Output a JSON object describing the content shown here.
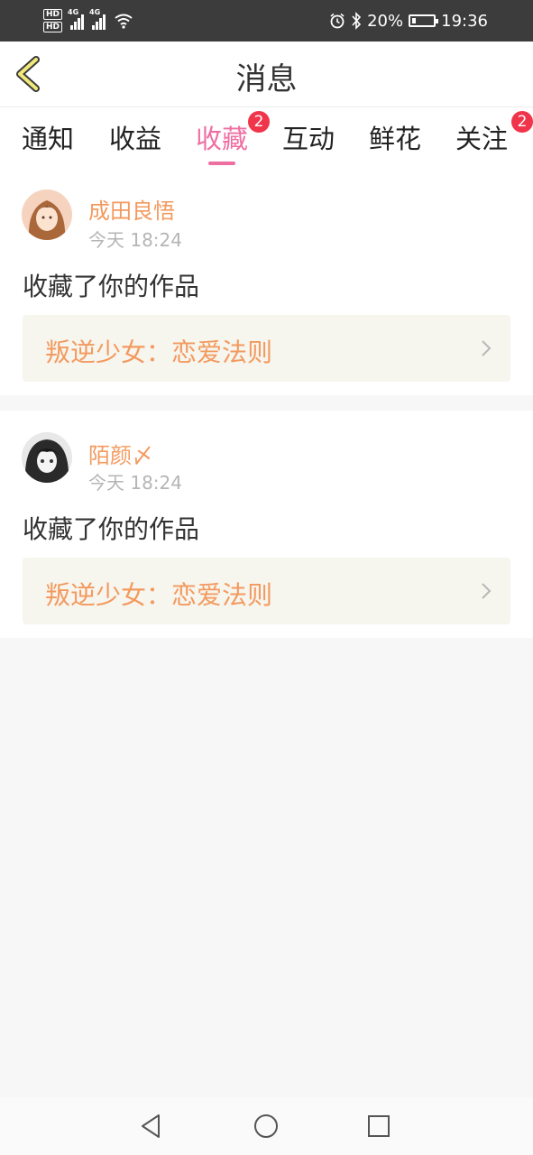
{
  "status_bar": {
    "time": "19:36",
    "battery": "20%",
    "battery_level": 0.2,
    "sim1_hd": "HD",
    "sim2_hd": "HD",
    "network1": "4G",
    "network2": "4G"
  },
  "header": {
    "title": "消息"
  },
  "tabs": [
    {
      "label": "通知",
      "badge": ""
    },
    {
      "label": "收益",
      "badge": ""
    },
    {
      "label": "收藏",
      "badge": "2",
      "active": true
    },
    {
      "label": "互动",
      "badge": ""
    },
    {
      "label": "鲜花",
      "badge": ""
    },
    {
      "label": "关注",
      "badge": "2"
    }
  ],
  "messages": [
    {
      "username": "成田良悟",
      "time": "今天 18:24",
      "action": "收藏了你的作品",
      "work_title": "叛逆少女：恋爱法则"
    },
    {
      "username": "陌颜〆",
      "time": "今天 18:24",
      "action": "收藏了你的作品",
      "work_title": "叛逆少女：恋爱法则"
    }
  ],
  "colors": {
    "accent_pink": "#ef6ea2",
    "username_orange": "#f39a5f",
    "badge_red": "#f0344a",
    "work_card_bg": "#f6f5ee"
  }
}
